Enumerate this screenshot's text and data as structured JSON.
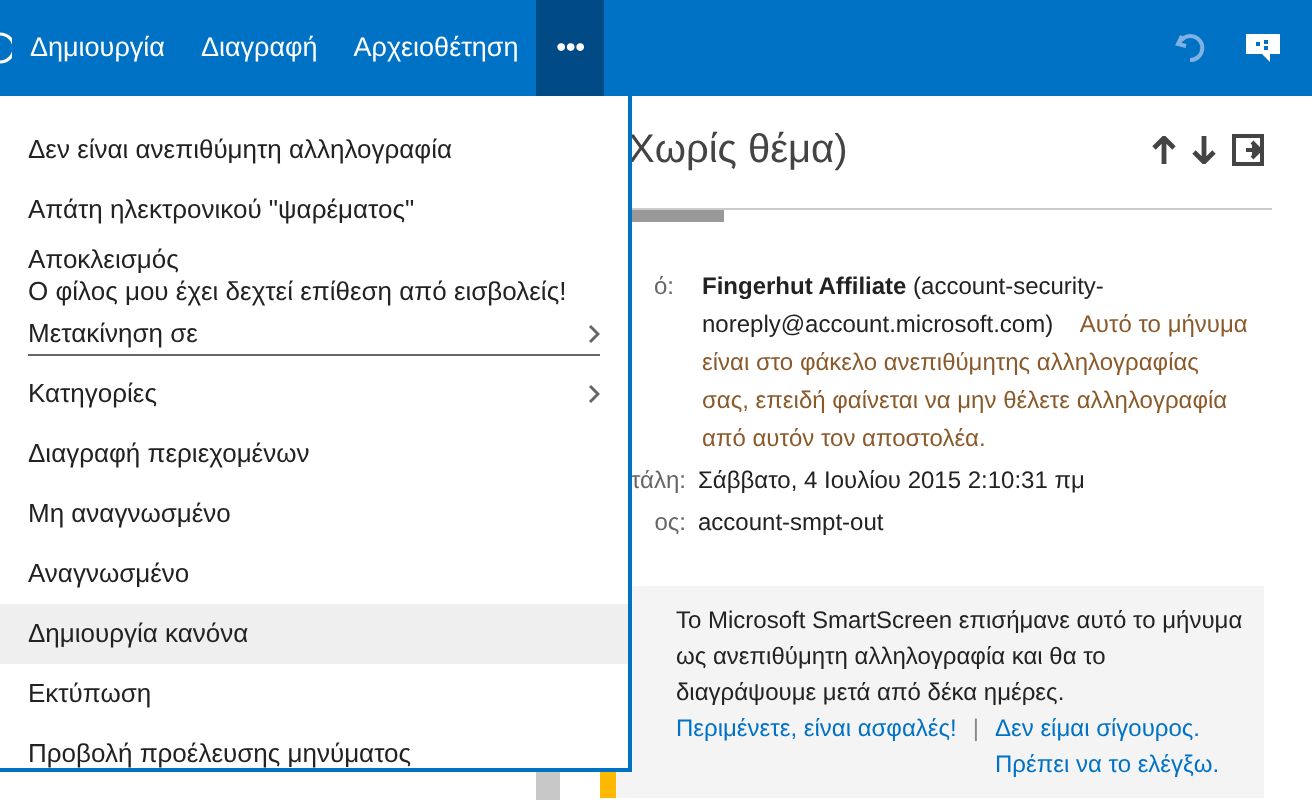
{
  "toolbar": {
    "commands": [
      {
        "label": "Δημιουργία",
        "selected": false
      },
      {
        "label": "Διαγραφή",
        "selected": false
      },
      {
        "label": "Αρχειοθέτηση",
        "selected": false
      },
      {
        "label": "•••",
        "selected": true
      }
    ]
  },
  "menu": {
    "items": [
      {
        "label": "Δεν είναι ανεπιθύμητη αλληλογραφία",
        "submenu": false,
        "highlighted": false,
        "divider_after": false
      },
      {
        "label": "Απάτη ηλεκτρονικού \"ψαρέματος\"",
        "submenu": false,
        "highlighted": false,
        "divider_after": false
      },
      {
        "label": "Αποκλεισμός",
        "submenu": false,
        "highlighted": false,
        "divider_after": false
      },
      {
        "label": "Ο φίλος μου έχει δεχτεί επίθεση από εισβολείς!",
        "submenu": false,
        "highlighted": false,
        "divider_after": false
      },
      {
        "label": "Μετακίνηση σε",
        "submenu": true,
        "highlighted": false,
        "divider_after": true
      },
      {
        "label": "Κατηγορίες",
        "submenu": true,
        "highlighted": false,
        "divider_after": false
      },
      {
        "label": "Διαγραφή περιεχομένων",
        "submenu": false,
        "highlighted": false,
        "divider_after": false
      },
      {
        "label": "Μη αναγνωσμένο",
        "submenu": false,
        "highlighted": false,
        "divider_after": false
      },
      {
        "label": "Αναγνωσμένο",
        "submenu": false,
        "highlighted": false,
        "divider_after": false
      },
      {
        "label": "Δημιουργία κανόνα",
        "submenu": false,
        "highlighted": true,
        "divider_after": false
      },
      {
        "label": "Εκτύπωση",
        "submenu": false,
        "highlighted": false,
        "divider_after": false
      },
      {
        "label": "Προβολή προέλευσης μηνύματος",
        "submenu": false,
        "highlighted": false,
        "divider_after": false
      }
    ]
  },
  "message": {
    "subject": "Χωρίς θέμα)",
    "headers": [
      {
        "label": "ό:",
        "value": "**Fingerhut Affiliate** (account-security-noreply@account.microsoft.com)",
        "note": "Αυτό το μήνυμα είναι στο φάκελο ανεπιθύμητης αλληλογραφίας σας, επειδή φαίνεται να μην θέλετε αλληλογραφία από αυτόν τον αποστολέα."
      },
      {
        "label": "τάλη:",
        "value": "Σάββατο, 4 Ιουλίου 2015 2:10:31 πμ"
      },
      {
        "label": "ος:",
        "value": "account-smpt-out"
      }
    ],
    "warning": {
      "text": "Το Microsoft SmartScreen επισήμανε αυτό το μήνυμα ως ανεπιθύμητη αλληλογραφία και θα το διαγράψουμε μετά από δέκα ημέρες.",
      "links": [
        "Περιμένετε, είναι ασφαλές!",
        "Δεν είμαι σίγουρος. Πρέπει να το ελέγξω."
      ],
      "separator": "|"
    }
  }
}
